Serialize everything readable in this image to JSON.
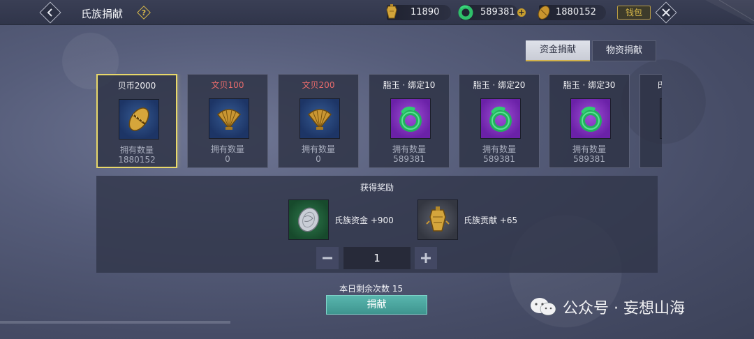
{
  "header": {
    "title": "氏族捐献",
    "help_icon": "?",
    "wallet_label": "钱包",
    "currencies": [
      {
        "icon": "bell-coin-icon",
        "value": "11890"
      },
      {
        "icon": "jade-icon",
        "value": "589381"
      },
      {
        "icon": "shell-coin-icon",
        "value": "1880152"
      }
    ],
    "plus_symbol": "+"
  },
  "tabs": [
    {
      "label": "资金捐献",
      "active": true
    },
    {
      "label": "物资捐献",
      "active": false
    }
  ],
  "cards": [
    {
      "name": "贝币2000",
      "own_label": "拥有数量",
      "own_value": "1880152",
      "item": "cowrie-shell-icon",
      "frame": "blue",
      "name_color": "white",
      "selected": true
    },
    {
      "name": "文贝100",
      "own_label": "拥有数量",
      "own_value": "0",
      "item": "scallop-shell-icon",
      "frame": "blue",
      "name_color": "red",
      "selected": false
    },
    {
      "name": "文贝200",
      "own_label": "拥有数量",
      "own_value": "0",
      "item": "scallop-shell-icon",
      "frame": "blue",
      "name_color": "red",
      "selected": false
    },
    {
      "name": "脂玉 · 绑定10",
      "own_label": "拥有数量",
      "own_value": "589381",
      "item": "jade-disc-icon",
      "frame": "purple",
      "name_color": "white",
      "selected": false
    },
    {
      "name": "脂玉 · 绑定20",
      "own_label": "拥有数量",
      "own_value": "589381",
      "item": "jade-disc-icon",
      "frame": "purple",
      "name_color": "white",
      "selected": false
    },
    {
      "name": "脂玉 · 绑定30",
      "own_label": "拥有数量",
      "own_value": "589381",
      "item": "jade-disc-icon",
      "frame": "purple",
      "name_color": "white",
      "selected": false
    },
    {
      "name": "氏",
      "own_label": "",
      "own_value": "",
      "item": "partial-card",
      "frame": "gray",
      "name_color": "white",
      "selected": false
    }
  ],
  "reward": {
    "title": "获得奖励",
    "items": [
      {
        "icon": "silver-coin-icon",
        "text": "氏族资金 +900"
      },
      {
        "icon": "gold-bell-icon",
        "text": "氏族贡献 +65"
      }
    ],
    "quantity": "1"
  },
  "remaining": "本日剩余次数  15",
  "donate_label": "捐献",
  "watermark": "公众号 · 妄想山海",
  "colors": {
    "accent_gold": "#d8b94a",
    "selected_border": "#e8d86a",
    "donate_teal": "#4aa8a0",
    "red_name": "#e86b6b"
  }
}
